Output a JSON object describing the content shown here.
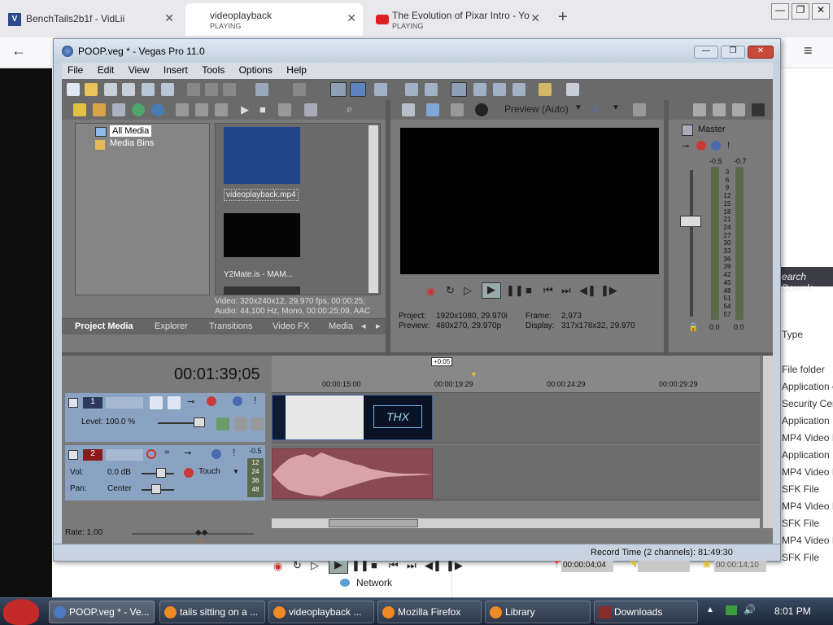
{
  "browser": {
    "tabs": [
      {
        "title": "BenchTails2b1f - VidLii",
        "sub": ""
      },
      {
        "title": "videoplayback",
        "sub": "PLAYING"
      },
      {
        "title": "The Evolution of Pixar Intro - Yo",
        "sub": "PLAYING"
      }
    ],
    "new_tab": "+"
  },
  "vegas": {
    "title": "POOP.veg * - Vegas Pro 11.0",
    "menu": [
      "File",
      "Edit",
      "View",
      "Insert",
      "Tools",
      "Options",
      "Help"
    ],
    "tree": {
      "all_media": "All Media",
      "media_bins": "Media Bins"
    },
    "media": {
      "item1": "videoplayback.mp4",
      "item2": "Y2Mate.is - MAM...",
      "info_video": "Video: 320x240x12, 29.970 fps, 00:00:25;",
      "info_audio": "Audio: 44,100 Hz, Mono, 00:00:25;09, AAC"
    },
    "tabs": [
      "Project Media",
      "Explorer",
      "Transitions",
      "Video FX",
      "Media"
    ],
    "preview": {
      "mode": "Preview (Auto)",
      "project_label": "Project:",
      "project_value": "1920x1080, 29.970i",
      "preview_label": "Preview:",
      "preview_value": "480x270, 29.970p",
      "frame_label": "Frame:",
      "frame_value": "2,973",
      "display_label": "Display:",
      "display_value": "317x178x32, 29.970"
    },
    "master": {
      "label": "Master",
      "left_db": "-0.5",
      "right_db": "-0.7",
      "scale": [
        "3",
        "6",
        "9",
        "12",
        "15",
        "18",
        "21",
        "24",
        "27",
        "30",
        "33",
        "36",
        "39",
        "42",
        "45",
        "48",
        "51",
        "54",
        "57"
      ],
      "bottom_left": "0.0",
      "bottom_right": "0.0"
    },
    "timeline": {
      "timecode": "00:01:39;05",
      "marker": "+0:05",
      "ruler": [
        "00:00:15:00",
        "00:00:19:29",
        "00:00:24:29",
        "00:00:29:29"
      ],
      "track1": {
        "number": "1",
        "level": "Level: 100.0 %",
        "clip_text": "THX"
      },
      "track2": {
        "number": "2",
        "vol_label": "Vol:",
        "vol_value": "0.0 dB",
        "pan_label": "Pan:",
        "pan_value": "Center",
        "mode": "Touch",
        "meter_top": "-0.5",
        "meter_scale": [
          "12",
          "24",
          "36",
          "48"
        ]
      },
      "rate": "Rate: 1.00",
      "cursor_time": "00:00:04;04",
      "end_time": "00:00:14;10",
      "status": "Record Time (2 channels): 81:49:30"
    }
  },
  "explorer": {
    "search": "earch Downlo",
    "type_header": "Type",
    "rows": [
      "File folder",
      "Application e",
      "Security Cert",
      "Application",
      "MP4 Video Fi",
      "Application",
      "MP4 Video Fi",
      "SFK File",
      "MP4 Video Fi",
      "SFK File",
      "MP4 Video Fi",
      "SFK File"
    ],
    "network": "Network"
  },
  "taskbar": {
    "items": [
      "POOP.veg * - Ve...",
      "tails sitting on a ...",
      "videoplayback ...",
      "Mozilla Firefox",
      "Library",
      "Downloads"
    ],
    "clock": "8:01 PM"
  }
}
